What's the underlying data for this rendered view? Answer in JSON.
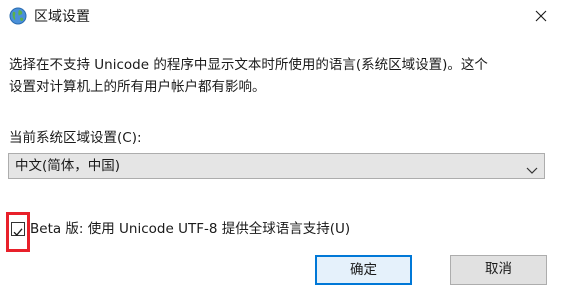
{
  "window": {
    "title": "区域设置",
    "close_icon": "close-icon",
    "app_icon": "globe-icon"
  },
  "description": {
    "line1": "选择在不支持 Unicode 的程序中显示文本时所使用的语言(系统区域设置)。这个",
    "line2": "设置对计算机上的所有用户帐户都有影响。"
  },
  "locale": {
    "label": "当前系统区域设置(C):",
    "selected": "中文(简体，中国)"
  },
  "beta_option": {
    "label": "Beta 版: 使用 Unicode UTF-8 提供全球语言支持(U)",
    "checked": true,
    "highlight_color": "#e8202a"
  },
  "buttons": {
    "ok": "确定",
    "cancel": "取消"
  },
  "colors": {
    "accent": "#0078d7",
    "highlight": "#e8202a"
  }
}
